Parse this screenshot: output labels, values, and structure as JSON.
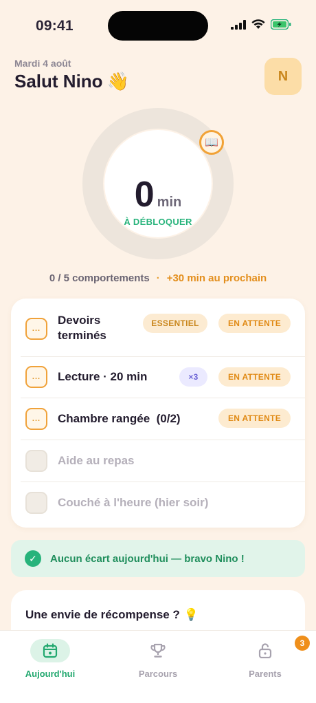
{
  "status_bar": {
    "time": "09:41"
  },
  "header": {
    "date": "Mardi 4 août",
    "greeting": "Salut Nino",
    "greeting_emoji": "👋",
    "avatar_initial": "N"
  },
  "ring": {
    "value": "0",
    "unit": "min",
    "caption": "À DÉBLOQUER",
    "badge_emoji": "📖",
    "progress_fraction": 0
  },
  "progress": {
    "count": "0 / 5 comportements",
    "separator": "·",
    "next": "+30 min au prochain"
  },
  "behaviors": [
    {
      "label": "Devoirs terminés",
      "check": "...",
      "tags": [
        "ESSENTIEL"
      ],
      "status": "EN ATTENTE"
    },
    {
      "label": "Lecture · 20 min",
      "check": "...",
      "multiplier": "×3",
      "status": "EN ATTENTE"
    },
    {
      "label": "Chambre rangée  (0/2)",
      "check": "...",
      "status": "EN ATTENTE"
    },
    {
      "label": "Aide au repas"
    },
    {
      "label": "Couché à l'heure (hier soir)"
    }
  ],
  "banner": {
    "icon": "check-icon",
    "text": "Aucun écart aujourd'hui — bravo Nino !"
  },
  "reward": {
    "title": "Une envie de récompense ?",
    "emoji": "💡"
  },
  "tabs": [
    {
      "label": "Aujourd'hui",
      "icon": "calendar-icon",
      "active": true
    },
    {
      "label": "Parcours",
      "icon": "trophy-icon"
    },
    {
      "label": "Parents",
      "icon": "lock-icon",
      "badge": "3"
    }
  ],
  "colors": {
    "accent_green": "#27b37b",
    "accent_orange": "#f0a23a",
    "background": "#fdf2e7"
  }
}
